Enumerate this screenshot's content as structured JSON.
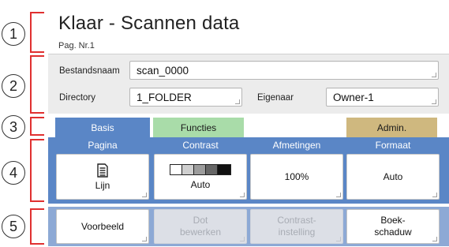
{
  "markers": [
    "1",
    "2",
    "3",
    "4",
    "5"
  ],
  "header": {
    "title": "Klaar - Scannen data",
    "subtitle": "Pag. Nr.1"
  },
  "form": {
    "filename_label": "Bestandsnaam",
    "filename_value": "scan_0000",
    "directory_label": "Directory",
    "directory_value": "1_FOLDER",
    "owner_label": "Eigenaar",
    "owner_value": "Owner-1"
  },
  "tabs": {
    "basis": "Basis",
    "functies": "Functies",
    "admin": "Admin."
  },
  "settings": {
    "pagina": {
      "header": "Pagina",
      "value": "Lijn",
      "icon": "document-icon"
    },
    "contrast": {
      "header": "Contrast",
      "value": "Auto",
      "icon": "contrast-scale-icon"
    },
    "afmetingen": {
      "header": "Afmetingen",
      "value": "100%"
    },
    "formaat": {
      "header": "Formaat",
      "value": "Auto"
    }
  },
  "actions": {
    "voorbeeld": "Voorbeeld",
    "dot_bewerken": "Dot\nbewerken",
    "contrast_instelling": "Contrast-\ninstelling",
    "boekschaduw": "Boek-\nschaduw"
  },
  "colors": {
    "marker_bracket": "#e03030",
    "basis_tab": "#5a86c6",
    "functies_tab": "#a9dca9",
    "admin_tab": "#cfb87f"
  }
}
